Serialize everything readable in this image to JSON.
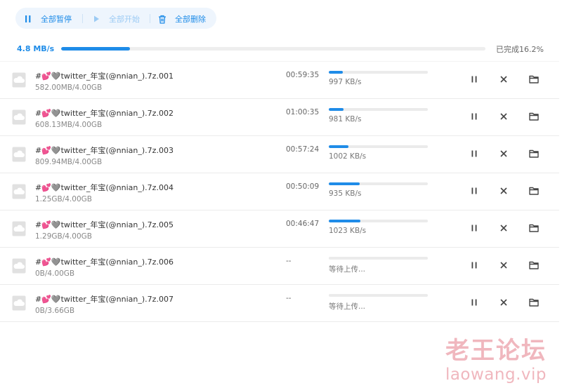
{
  "toolbar": {
    "pause_all_label": "全部暂停",
    "start_all_label": "全部开始",
    "delete_all_label": "全部删除"
  },
  "summary": {
    "speed": "4.8 MB/s",
    "status": "已完成16.2%",
    "progress_percent": 16.2
  },
  "downloads": [
    {
      "name": "#💕🩶twitter_年宝(@nnian_).7z.001",
      "size": "582.00MB/4.00GB",
      "eta": "00:59:35",
      "rate": "997 KB/s",
      "progress_percent": 14
    },
    {
      "name": "#💕🩶twitter_年宝(@nnian_).7z.002",
      "size": "608.13MB/4.00GB",
      "eta": "01:00:35",
      "rate": "981 KB/s",
      "progress_percent": 15
    },
    {
      "name": "#💕🩶twitter_年宝(@nnian_).7z.003",
      "size": "809.94MB/4.00GB",
      "eta": "00:57:24",
      "rate": "1002 KB/s",
      "progress_percent": 20
    },
    {
      "name": "#💕🩶twitter_年宝(@nnian_).7z.004",
      "size": "1.25GB/4.00GB",
      "eta": "00:50:09",
      "rate": "935 KB/s",
      "progress_percent": 31
    },
    {
      "name": "#💕🩶twitter_年宝(@nnian_).7z.005",
      "size": "1.29GB/4.00GB",
      "eta": "00:46:47",
      "rate": "1023 KB/s",
      "progress_percent": 32
    },
    {
      "name": "#💕🩶twitter_年宝(@nnian_).7z.006",
      "size": "0B/4.00GB",
      "eta": "--",
      "rate": "等待上传...",
      "progress_percent": 0
    },
    {
      "name": "#💕🩶twitter_年宝(@nnian_).7z.007",
      "size": "0B/3.66GB",
      "eta": "--",
      "rate": "等待上传...",
      "progress_percent": 0
    }
  ],
  "icons": {
    "file": "cloud-file-icon",
    "pause": "pause-icon",
    "cancel": "close-icon",
    "folder": "folder-icon"
  },
  "colors": {
    "accent": "#1f8ce8",
    "toolbar_bg": "#eef5fd",
    "disabled": "#9ccbf4",
    "watermark": "#f0b7be"
  },
  "watermark": {
    "title": "老王论坛",
    "url": "laowang.vip"
  }
}
